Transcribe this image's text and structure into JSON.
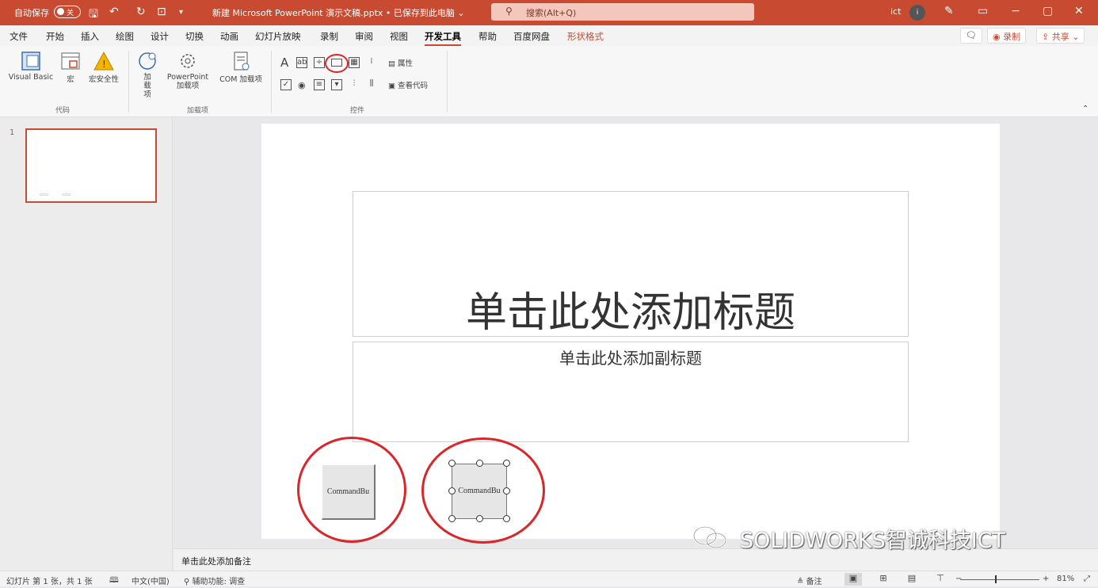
{
  "titlebar": {
    "autosave_label": "自动保存",
    "autosave_state": "关",
    "doc_title": "新建 Microsoft PowerPoint 演示文稿.pptx • 已保存到此电脑 ⌄",
    "search_placeholder": "搜索(Alt+Q)",
    "user_initials": "ict",
    "avatar_letter": "i"
  },
  "menu": {
    "tabs": [
      "文件",
      "开始",
      "插入",
      "绘图",
      "设计",
      "切换",
      "动画",
      "幻灯片放映",
      "录制",
      "审阅",
      "视图",
      "开发工具",
      "帮助",
      "百度网盘",
      "形状格式"
    ],
    "active_tab": "开发工具",
    "record_label": "录制",
    "share_label": "共享"
  },
  "ribbon": {
    "code": {
      "visual_basic": "Visual Basic",
      "macros": "宏",
      "macro_security": "宏安全性",
      "group": "代码"
    },
    "addins": {
      "addins": "加载项",
      "ppt_addins": "PowerPoint 加载项",
      "com_addins": "COM 加载项",
      "group": "加载项"
    },
    "controls": {
      "properties": "属性",
      "view_code": "查看代码",
      "group": "控件"
    }
  },
  "slides_panel": {
    "number": "1"
  },
  "slide": {
    "title_placeholder": "单击此处添加标题",
    "subtitle_placeholder": "单击此处添加副标题",
    "button1_caption": "CommandBu",
    "button2_caption": "CommandBu"
  },
  "notes": {
    "placeholder": "单击此处添加备注"
  },
  "watermark": {
    "text": "SOLIDWORKS智诚科技ICT"
  },
  "status": {
    "slide_count": "幻灯片 第 1 张，共 1 张",
    "language": "中文(中国)",
    "accessibility": "辅助功能: 调查",
    "notes_btn": "备注",
    "zoom": "81%"
  },
  "colors": {
    "accent": "#c84a31",
    "highlight_ring": "#d9262b"
  }
}
